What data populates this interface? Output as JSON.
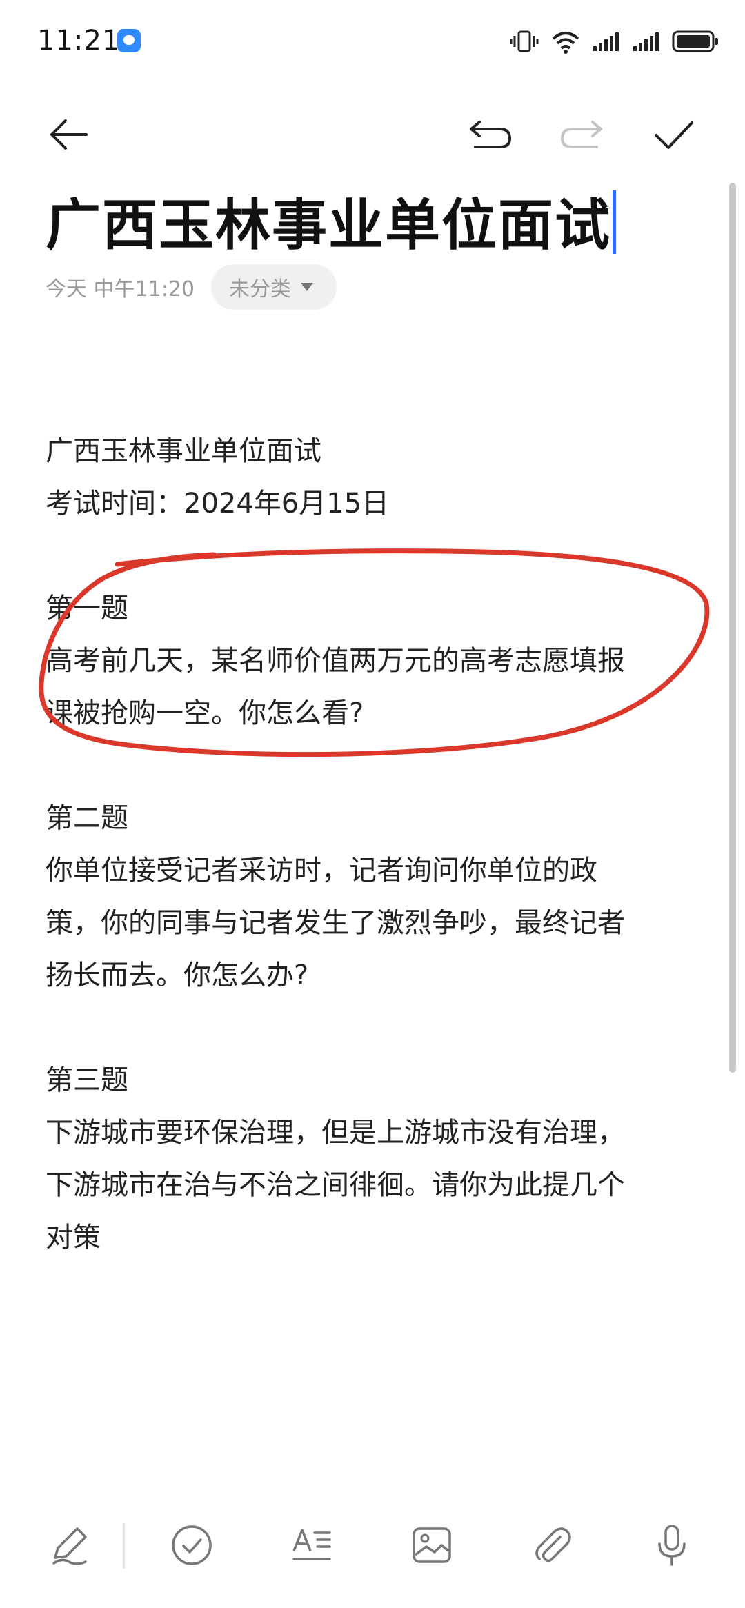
{
  "status_bar": {
    "time": "11:21"
  },
  "note": {
    "title": "广西玉林事业单位面试",
    "date": "今天 中午11:20",
    "category": "未分类",
    "lines": [
      "广西玉林事业单位面试",
      "考试时间：2024年6月15日",
      "",
      "第一题",
      "高考前几天，某名师价值两万元的高考志愿填报",
      "课被抢购一空。你怎么看?",
      "",
      "第二题",
      "你单位接受记者采访时，记者询问你单位的政",
      "策，你的同事与记者发生了激烈争吵，最终记者",
      "扬长而去。你怎么办?",
      "",
      "第三题",
      "下游城市要环保治理，但是上游城市没有治理，",
      "下游城市在治与不治之间徘徊。请你为此提几个",
      "对策"
    ]
  },
  "colors": {
    "caret": "#2f6bff",
    "annotation": "#d9382b",
    "notification": "#2f8bff"
  },
  "icons": {
    "toolbar": [
      "back-arrow-icon",
      "undo-icon",
      "redo-icon",
      "checkmark-icon"
    ],
    "bottom": [
      "pen-icon",
      "checklist-icon",
      "text-format-icon",
      "image-icon",
      "attachment-icon",
      "microphone-icon"
    ]
  }
}
